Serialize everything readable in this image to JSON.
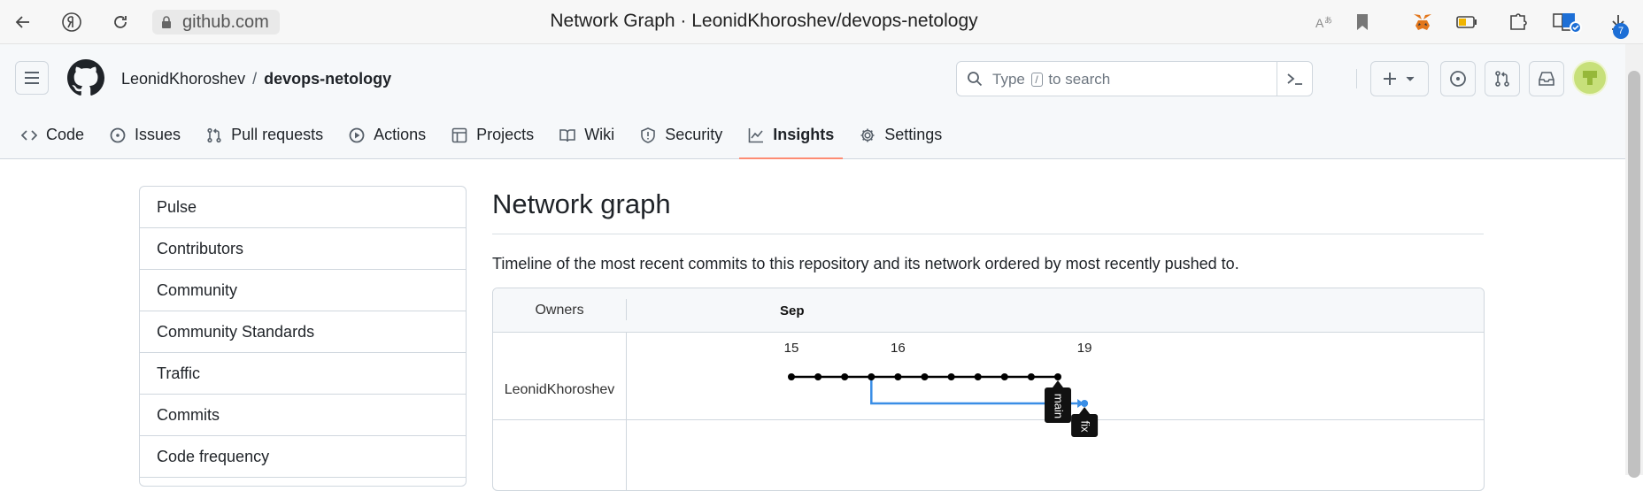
{
  "browser": {
    "url": "github.com",
    "tab_title": "Network Graph · LeonidKhoroshev/devops-netology",
    "downloads_count": "7"
  },
  "header": {
    "owner": "LeonidKhoroshev",
    "separator": "/",
    "repo": "devops-netology",
    "search_prefix": "Type",
    "search_key": "/",
    "search_suffix": "to search"
  },
  "nav": [
    {
      "label": "Code",
      "icon": "code-icon"
    },
    {
      "label": "Issues",
      "icon": "issue-icon"
    },
    {
      "label": "Pull requests",
      "icon": "pull-request-icon"
    },
    {
      "label": "Actions",
      "icon": "play-icon"
    },
    {
      "label": "Projects",
      "icon": "table-icon"
    },
    {
      "label": "Wiki",
      "icon": "book-icon"
    },
    {
      "label": "Security",
      "icon": "shield-icon"
    },
    {
      "label": "Insights",
      "icon": "graph-icon",
      "active": true
    },
    {
      "label": "Settings",
      "icon": "gear-icon"
    }
  ],
  "sidebar": {
    "items": [
      {
        "label": "Pulse"
      },
      {
        "label": "Contributors"
      },
      {
        "label": "Community"
      },
      {
        "label": "Community Standards"
      },
      {
        "label": "Traffic"
      },
      {
        "label": "Commits"
      },
      {
        "label": "Code frequency"
      }
    ]
  },
  "main": {
    "title": "Network graph",
    "description": "Timeline of the most recent commits to this repository and its network ordered by most recently pushed to."
  },
  "graph": {
    "owners_header": "Owners",
    "month": "Sep",
    "owner": "LeonidKhoroshev",
    "days": [
      "15",
      "16",
      "19"
    ],
    "main_commit_count": 11,
    "branches": [
      {
        "name": "main",
        "color": "#000000"
      },
      {
        "name": "fix",
        "color": "#3a8ee6"
      }
    ]
  }
}
